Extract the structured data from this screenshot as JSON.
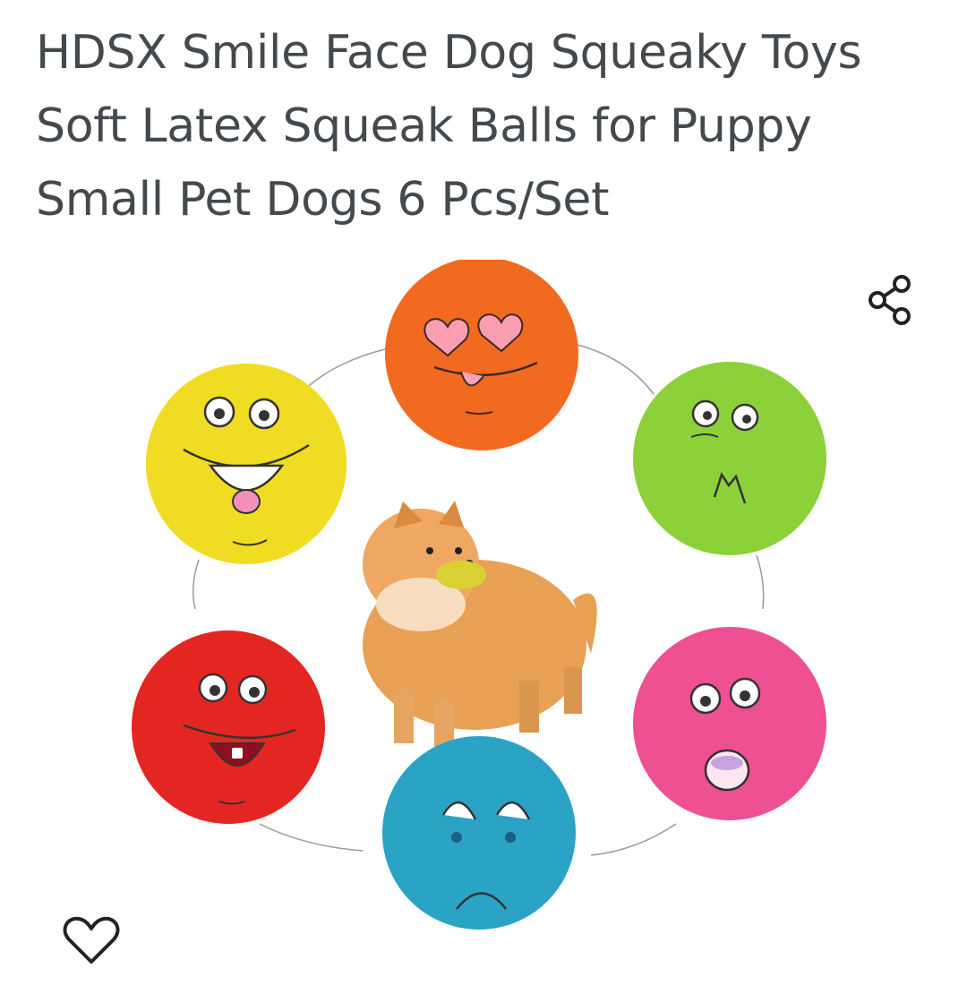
{
  "product": {
    "title": "HDSX Smile Face Dog Squeaky Toys Soft Latex Squeak Balls for Puppy Small Pet Dogs 6 Pcs/Set",
    "image": {
      "items": [
        {
          "name": "ball-orange-heart-eyes",
          "color": "#f26a1f"
        },
        {
          "name": "ball-green-grumpy",
          "color": "#8cd13a"
        },
        {
          "name": "ball-pink-surprised",
          "color": "#ef4f93"
        },
        {
          "name": "ball-blue-sad",
          "color": "#2aa3c4"
        },
        {
          "name": "ball-red-tongue",
          "color": "#e42622"
        },
        {
          "name": "ball-yellow-tongue",
          "color": "#f0dc22"
        }
      ]
    }
  },
  "actions": {
    "share_icon": "share-icon",
    "wishlist_icon": "heart-outline-icon"
  }
}
